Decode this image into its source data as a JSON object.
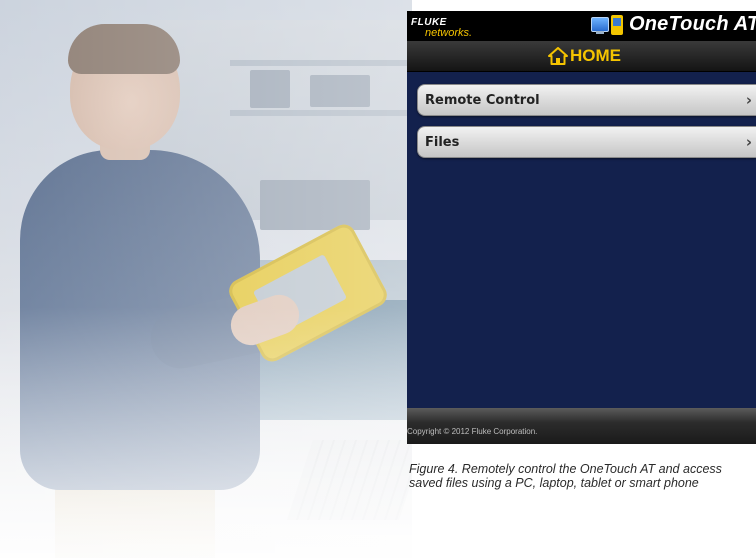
{
  "app": {
    "brand_top": "FLUKE",
    "brand_bottom": "networks.",
    "product_name": "OneTouch AT",
    "nav_title": "HOME",
    "menu": [
      {
        "label": "Remote Control"
      },
      {
        "label": "Files"
      }
    ],
    "copyright": "Copyright © 2012 Fluke Corporation."
  },
  "caption": "Figure 4. Remotely control the OneTouch AT and access saved files using a PC, laptop, tablet or smart phone",
  "colors": {
    "app_background": "#13214d",
    "accent_yellow": "#f5c400",
    "header_black": "#000000"
  },
  "icons": {
    "nav": "home-icon",
    "menu_item": "chevron-right-icon",
    "product": [
      "pc-icon",
      "tester-icon"
    ]
  }
}
